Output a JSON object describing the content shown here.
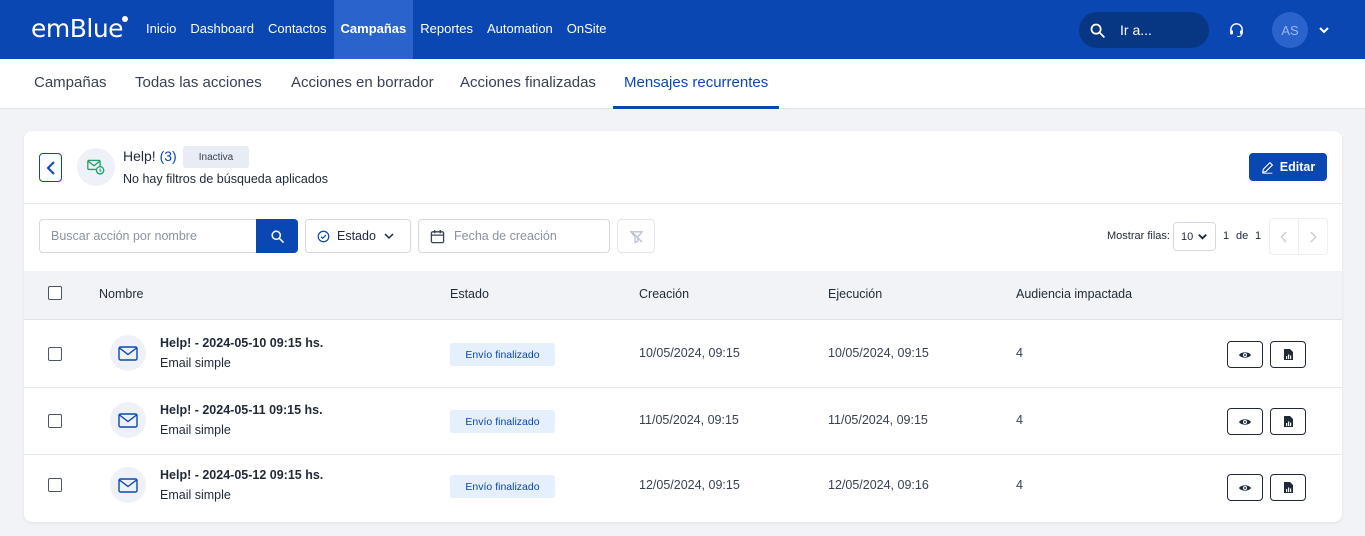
{
  "header": {
    "logo": "emBlue",
    "nav": [
      {
        "label": "Inicio",
        "active": false
      },
      {
        "label": "Dashboard",
        "active": false
      },
      {
        "label": "Contactos",
        "active": false
      },
      {
        "label": "Campañas",
        "active": true
      },
      {
        "label": "Reportes",
        "active": false
      },
      {
        "label": "Automation",
        "active": false
      },
      {
        "label": "OnSite",
        "active": false
      }
    ],
    "goto_label": "Ir a...",
    "avatar_initials": "AS"
  },
  "subnav": {
    "tabs": [
      {
        "label": "Campañas",
        "active": false
      },
      {
        "label": "Todas las acciones",
        "active": false
      },
      {
        "label": "Acciones en borrador",
        "active": false
      },
      {
        "label": "Acciones finalizadas",
        "active": false
      },
      {
        "label": "Mensajes recurrentes",
        "active": true
      }
    ]
  },
  "detail": {
    "title": "Help!",
    "count": "(3)",
    "status": "Inactiva",
    "subtitle": "No hay filtros de búsqueda aplicados",
    "edit_label": "Editar"
  },
  "filters": {
    "search_placeholder": "Buscar acción por nombre",
    "estado_label": "Estado",
    "date_placeholder": "Fecha de creación",
    "rows_label": "Mostrar filas:",
    "rows_value": "10",
    "page_current": "1",
    "page_of": "de",
    "page_total": "1"
  },
  "table": {
    "columns": [
      "Nombre",
      "Estado",
      "Creación",
      "Ejecución",
      "Audiencia impactada"
    ],
    "rows": [
      {
        "name": "Help! - 2024-05-10 09:15 hs.",
        "type": "Email simple",
        "status": "Envío finalizado",
        "created": "10/05/2024, 09:15",
        "executed": "10/05/2024, 09:15",
        "audience": "4"
      },
      {
        "name": "Help! - 2024-05-11 09:15 hs.",
        "type": "Email simple",
        "status": "Envío finalizado",
        "created": "11/05/2024, 09:15",
        "executed": "11/05/2024, 09:15",
        "audience": "4"
      },
      {
        "name": "Help! - 2024-05-12 09:15 hs.",
        "type": "Email simple",
        "status": "Envío finalizado",
        "created": "12/05/2024, 09:15",
        "executed": "12/05/2024, 09:16",
        "audience": "4"
      }
    ]
  },
  "colors": {
    "primary": "#0a47b3",
    "nav_active": "#2b63cc",
    "badge_bg": "#e6effc"
  }
}
